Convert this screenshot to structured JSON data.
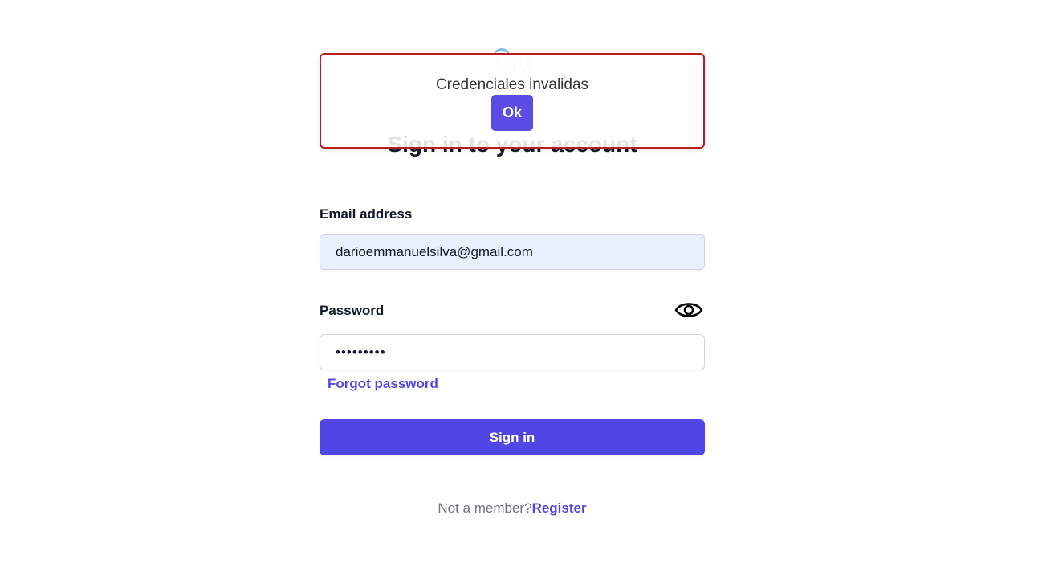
{
  "logo": {
    "text": "SN"
  },
  "heading": "Sign in to your account",
  "form": {
    "email_label": "Email address",
    "email_value": "darioemmanuelsilva@gmail.com",
    "password_label": "Password",
    "password_value": "•••••••••",
    "password_toggle_icon": "eye-icon",
    "forgot_label": "Forgot password",
    "signin_label": "Sign in"
  },
  "footer": {
    "prompt": "Not a member?",
    "register_label": "Register"
  },
  "alert": {
    "message": "Credenciales invalidas",
    "ok_label": "Ok",
    "border_color": "#b91c1c"
  },
  "colors": {
    "accent": "#4f46e5",
    "input_autofill_bg": "#e8f0fe"
  }
}
